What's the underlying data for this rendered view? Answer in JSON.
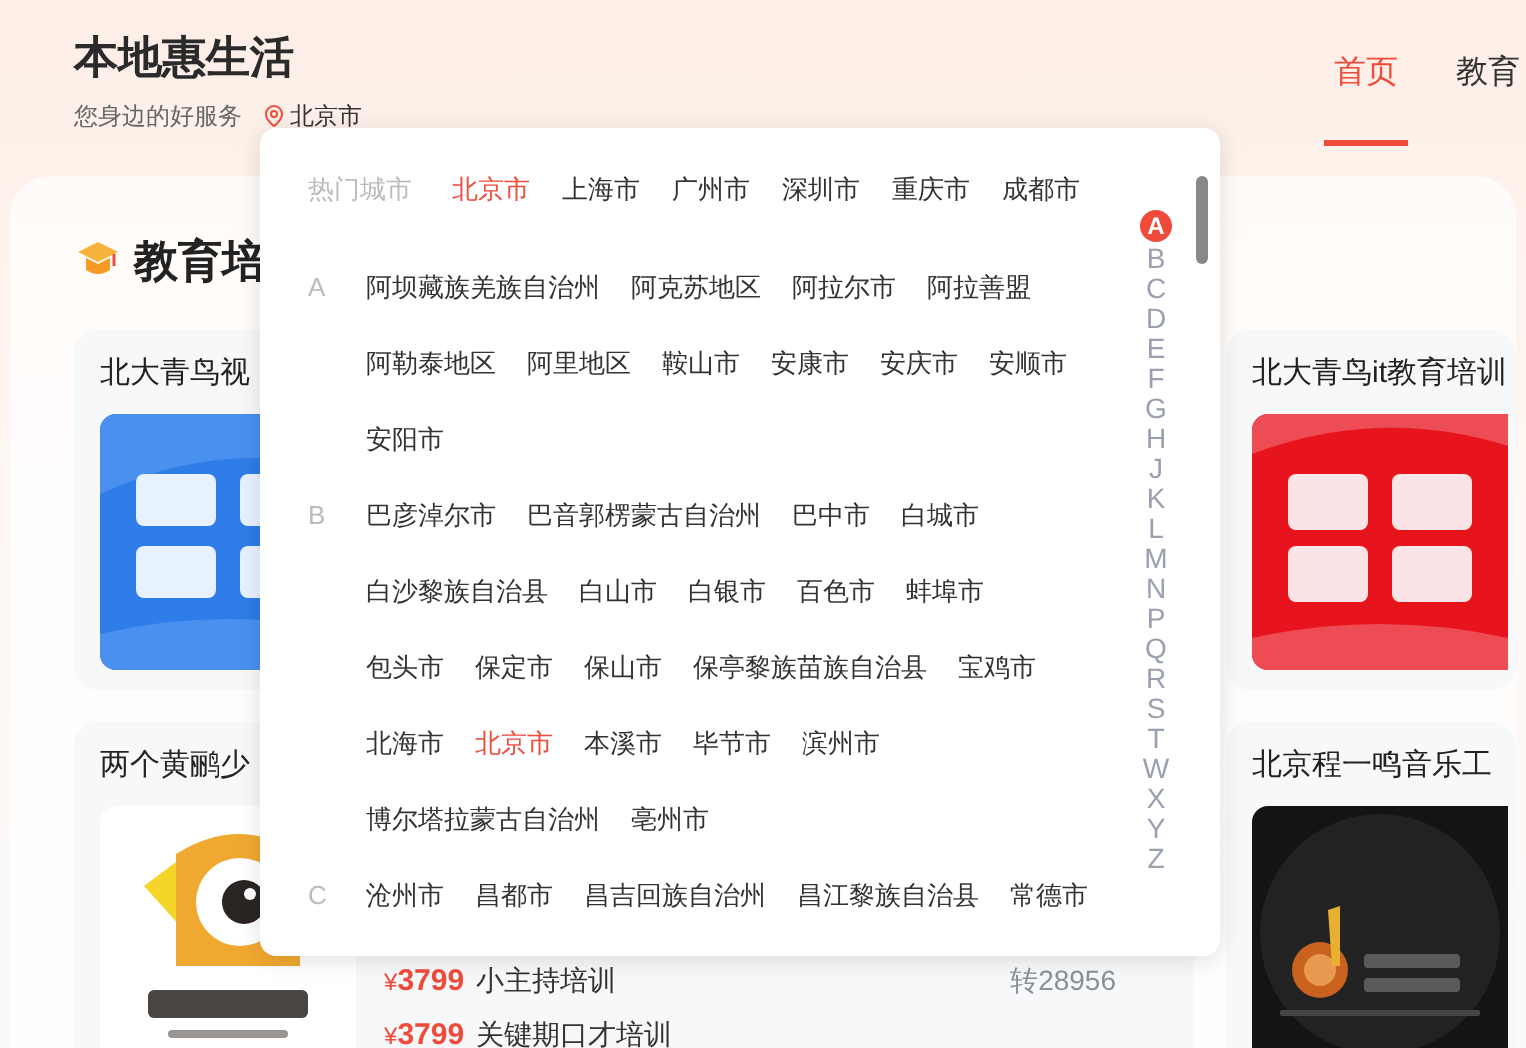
{
  "header": {
    "logo": "本地惠生活",
    "slogan": "您身边的好服务",
    "location": "北京市",
    "nav": [
      {
        "label": "首页",
        "selected": true
      },
      {
        "label": "教育",
        "selected": false
      }
    ]
  },
  "section": {
    "title": "教育培"
  },
  "cards": [
    {
      "title": "北大青鸟视",
      "kind": "blue"
    },
    {
      "title": "北大青鸟it教育培训",
      "kind": "red"
    },
    {
      "title": "两个黄鹂少",
      "kind": "bird",
      "courses": [
        {
          "currency": "¥",
          "price": "3799",
          "name": "小主持培训"
        },
        {
          "currency": "¥",
          "price": "3799",
          "name": "关键期口才培训"
        }
      ],
      "extension": "转28956"
    },
    {
      "title": "北京程一鸣音乐工",
      "kind": "dark"
    }
  ],
  "city_picker": {
    "hot_label": "热门城市",
    "hot_cities": [
      {
        "name": "北京市",
        "selected": true
      },
      {
        "name": "上海市",
        "selected": false
      },
      {
        "name": "广州市",
        "selected": false
      },
      {
        "name": "深圳市",
        "selected": false
      },
      {
        "name": "重庆市",
        "selected": false
      },
      {
        "name": "成都市",
        "selected": false
      }
    ],
    "groups": [
      {
        "letter": "A",
        "cities": [
          {
            "name": "阿坝藏族羌族自治州",
            "selected": false
          },
          {
            "name": "阿克苏地区",
            "selected": false
          },
          {
            "name": "阿拉尔市",
            "selected": false
          },
          {
            "name": "阿拉善盟",
            "selected": false
          },
          {
            "name": "阿勒泰地区",
            "selected": false
          },
          {
            "name": "阿里地区",
            "selected": false
          },
          {
            "name": "鞍山市",
            "selected": false
          },
          {
            "name": "安康市",
            "selected": false
          },
          {
            "name": "安庆市",
            "selected": false
          },
          {
            "name": "安顺市",
            "selected": false
          },
          {
            "name": "安阳市",
            "selected": false
          }
        ]
      },
      {
        "letter": "B",
        "cities": [
          {
            "name": "巴彦淖尔市",
            "selected": false
          },
          {
            "name": "巴音郭楞蒙古自治州",
            "selected": false
          },
          {
            "name": "巴中市",
            "selected": false
          },
          {
            "name": "白城市",
            "selected": false
          },
          {
            "name": "白沙黎族自治县",
            "selected": false
          },
          {
            "name": "白山市",
            "selected": false
          },
          {
            "name": "白银市",
            "selected": false
          },
          {
            "name": "百色市",
            "selected": false
          },
          {
            "name": "蚌埠市",
            "selected": false
          },
          {
            "name": "包头市",
            "selected": false
          },
          {
            "name": "保定市",
            "selected": false
          },
          {
            "name": "保山市",
            "selected": false
          },
          {
            "name": "保亭黎族苗族自治县",
            "selected": false
          },
          {
            "name": "宝鸡市",
            "selected": false
          },
          {
            "name": "北海市",
            "selected": false
          },
          {
            "name": "北京市",
            "selected": true
          },
          {
            "name": "本溪市",
            "selected": false
          },
          {
            "name": "毕节市",
            "selected": false
          },
          {
            "name": "滨州市",
            "selected": false
          },
          {
            "name": "博尔塔拉蒙古自治州",
            "selected": false
          },
          {
            "name": "亳州市",
            "selected": false
          }
        ]
      },
      {
        "letter": "C",
        "cities": [
          {
            "name": "沧州市",
            "selected": false
          },
          {
            "name": "昌都市",
            "selected": false
          },
          {
            "name": "昌吉回族自治州",
            "selected": false
          },
          {
            "name": "昌江黎族自治县",
            "selected": false
          },
          {
            "name": "常德市",
            "selected": false
          }
        ]
      }
    ],
    "index": [
      {
        "letter": "A",
        "selected": true
      },
      {
        "letter": "B",
        "selected": false
      },
      {
        "letter": "C",
        "selected": false
      },
      {
        "letter": "D",
        "selected": false
      },
      {
        "letter": "E",
        "selected": false
      },
      {
        "letter": "F",
        "selected": false
      },
      {
        "letter": "G",
        "selected": false
      },
      {
        "letter": "H",
        "selected": false
      },
      {
        "letter": "J",
        "selected": false
      },
      {
        "letter": "K",
        "selected": false
      },
      {
        "letter": "L",
        "selected": false
      },
      {
        "letter": "M",
        "selected": false
      },
      {
        "letter": "N",
        "selected": false
      },
      {
        "letter": "P",
        "selected": false
      },
      {
        "letter": "Q",
        "selected": false
      },
      {
        "letter": "R",
        "selected": false
      },
      {
        "letter": "S",
        "selected": false
      },
      {
        "letter": "T",
        "selected": false
      },
      {
        "letter": "W",
        "selected": false
      },
      {
        "letter": "X",
        "selected": false
      },
      {
        "letter": "Y",
        "selected": false
      },
      {
        "letter": "Z",
        "selected": false
      }
    ]
  }
}
